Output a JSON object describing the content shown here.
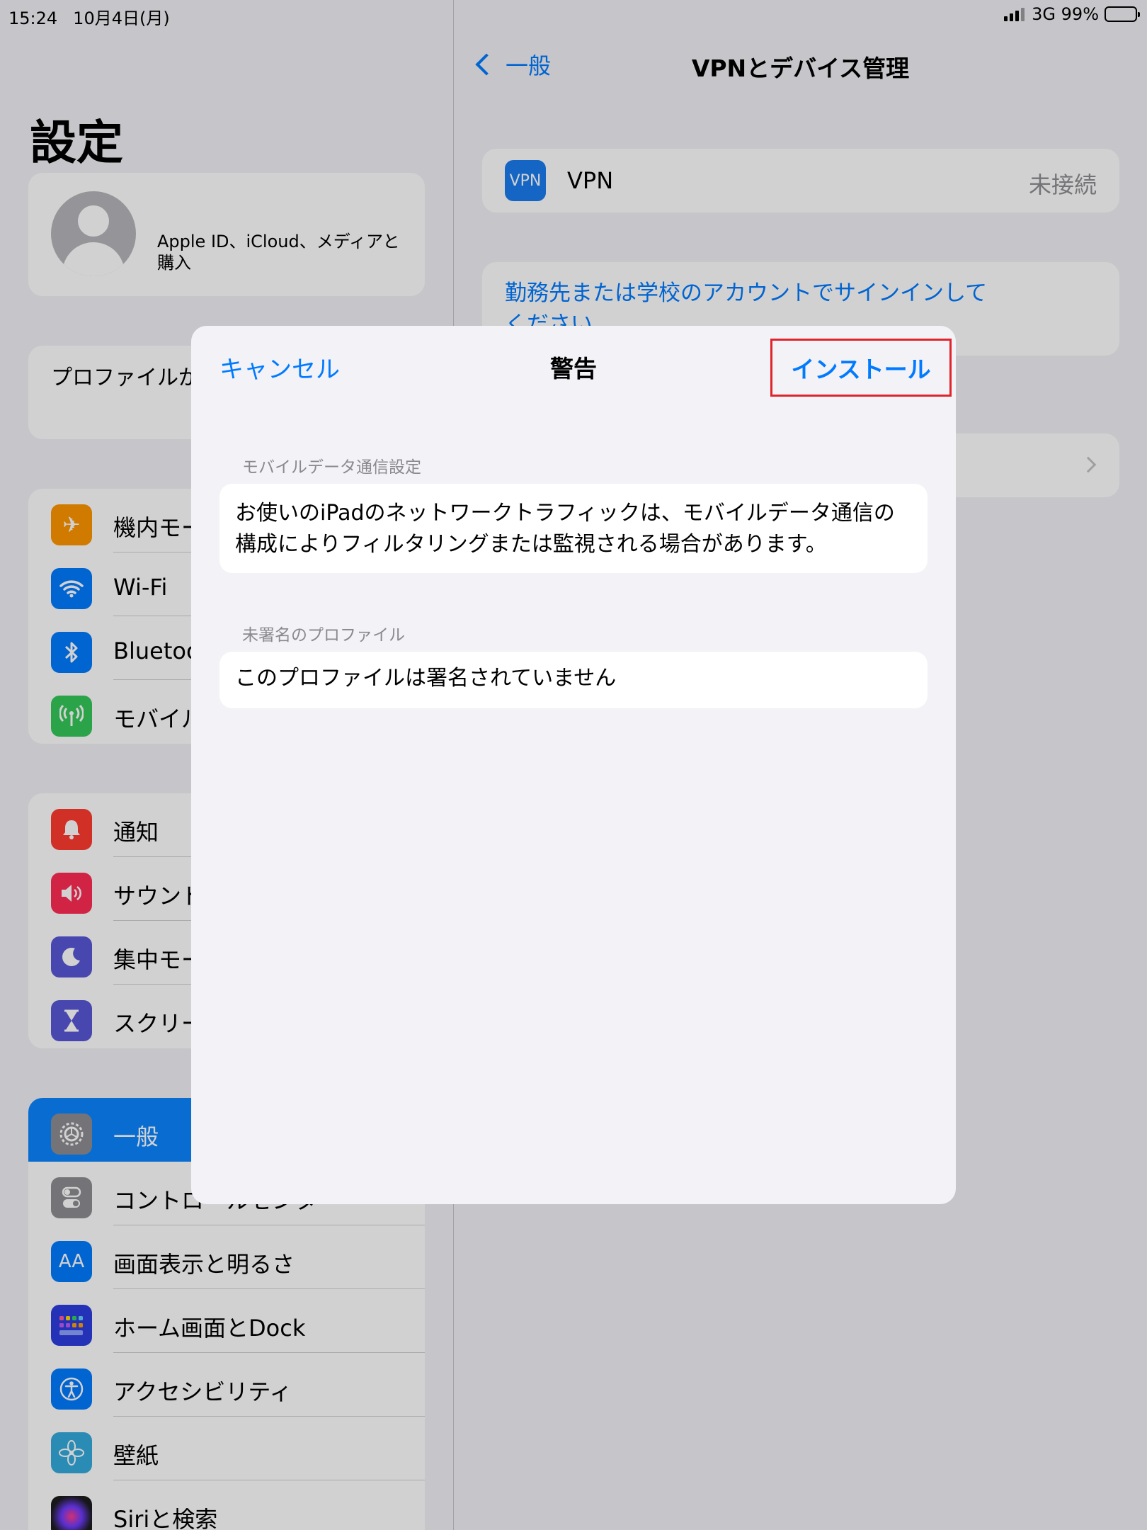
{
  "status_bar": {
    "time": "15:24",
    "date": "10月4日(月)",
    "network": "3G",
    "battery": "99%"
  },
  "sidebar": {
    "title": "設定",
    "profile_label": "Apple ID、iCloud、メディアと購入",
    "notice": "プロファイルがダウンロード済み",
    "group1": [
      {
        "label": "機内モード",
        "icon": "airplane-icon",
        "color": "#ff9500"
      },
      {
        "label": "Wi-Fi",
        "icon": "wifi-icon",
        "color": "#007aff"
      },
      {
        "label": "Bluetooth",
        "icon": "bluetooth-icon",
        "color": "#007aff"
      },
      {
        "label": "モバイルデータ通信",
        "icon": "antenna-icon",
        "color": "#34c759"
      }
    ],
    "group2": [
      {
        "label": "通知",
        "icon": "bell-icon",
        "color": "#ff3b30"
      },
      {
        "label": "サウンド",
        "icon": "speaker-icon",
        "color": "#ff2d55"
      },
      {
        "label": "集中モード",
        "icon": "moon-icon",
        "color": "#5856d6"
      },
      {
        "label": "スクリーンタイム",
        "icon": "hourglass-icon",
        "color": "#5856d6"
      }
    ],
    "group3": [
      {
        "label": "一般",
        "icon": "gear-icon",
        "color": "#8e8e93"
      },
      {
        "label": "コントロールセンター",
        "icon": "toggle-icon",
        "color": "#8e8e93"
      },
      {
        "label": "画面表示と明るさ",
        "icon": "text-size-icon",
        "color": "#007aff"
      },
      {
        "label": "ホーム画面とDock",
        "icon": "home-grid-icon",
        "color": "#2c3ee0"
      },
      {
        "label": "アクセシビリティ",
        "icon": "accessibility-icon",
        "color": "#007aff"
      },
      {
        "label": "壁紙",
        "icon": "flower-icon",
        "color": "#34aadc"
      },
      {
        "label": "Siriと検索",
        "icon": "siri-icon",
        "color": "#222222"
      }
    ]
  },
  "detail": {
    "back_label": "一般",
    "title": "VPNとデバイス管理",
    "vpn_icon_text": "VPN",
    "vpn_label": "VPN",
    "vpn_status": "未接続",
    "signin_text": "勤務先または学校のアカウントでサインインしてください"
  },
  "modal": {
    "cancel": "キャンセル",
    "title": "警告",
    "install": "インストール",
    "section1_header": "モバイルデータ通信設定",
    "section1_body": "お使いのiPadのネットワークトラフィックは、モバイルデータ通信の構成によりフィルタリングまたは監視される場合があります。",
    "section2_header": "未署名のプロファイル",
    "section2_body": "このプロファイルは署名されていません"
  },
  "colors": {
    "accent": "#007aff",
    "highlight_box": "#e0242c",
    "selected_row": "#0a84ff"
  }
}
